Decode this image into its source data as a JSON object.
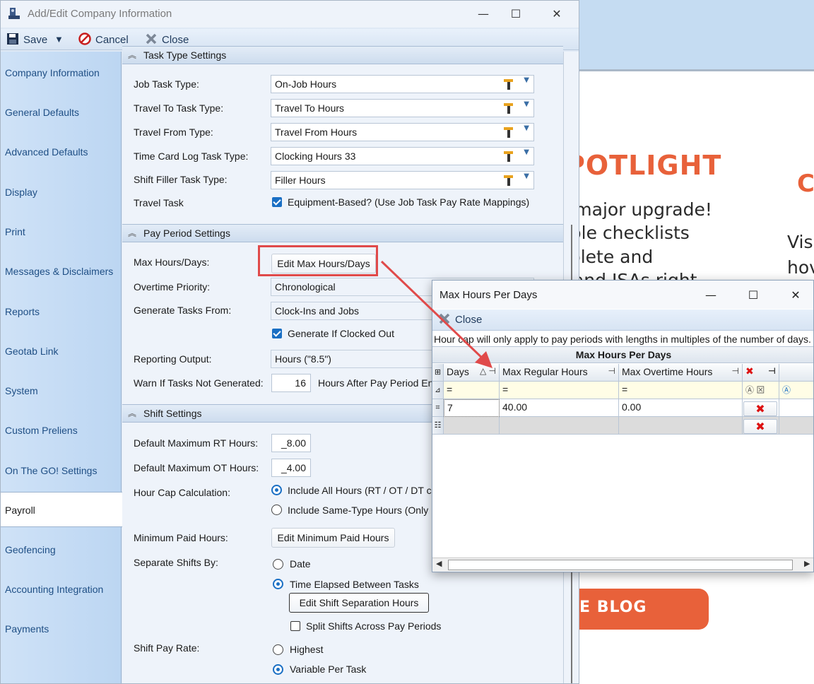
{
  "background_page": {
    "heading_fragment": "POTLIGHT",
    "right_letter": "C",
    "lines": [
      "a major upgrade!",
      "tiple checklists",
      "nplete and",
      "s and JSAs right"
    ],
    "right_lines": [
      "Vis",
      "hov"
    ],
    "blog_button": "E BLOG",
    "accent_color": "#e8613a"
  },
  "window": {
    "title": "Add/Edit Company Information",
    "controls": {
      "minimize": "—",
      "maximize": "☐",
      "close": "✕"
    }
  },
  "toolbar": {
    "save_label": "Save",
    "cancel_label": "Cancel",
    "close_label": "Close"
  },
  "sidebar": {
    "items": [
      {
        "label": "Company Information"
      },
      {
        "label": "General Defaults"
      },
      {
        "label": "Advanced Defaults"
      },
      {
        "label": "Display"
      },
      {
        "label": "Print"
      },
      {
        "label": "Messages & Disclaimers"
      },
      {
        "label": "Reports"
      },
      {
        "label": "Geotab Link"
      },
      {
        "label": "System"
      },
      {
        "label": "Custom Preliens"
      },
      {
        "label": "On The GO! Settings"
      },
      {
        "label": "Payroll",
        "active": true
      },
      {
        "label": "Geofencing"
      },
      {
        "label": "Accounting Integration"
      },
      {
        "label": "Payments"
      }
    ]
  },
  "task_type_settings": {
    "header": "Task Type Settings",
    "job_task_type": {
      "label": "Job Task Type:",
      "value": "On-Job Hours"
    },
    "travel_to": {
      "label": "Travel To Task Type:",
      "value": "Travel To Hours"
    },
    "travel_from": {
      "label": "Travel From Type:",
      "value": "Travel From Hours"
    },
    "time_card": {
      "label": "Time Card Log Task Type:",
      "value": "Clocking Hours 33"
    },
    "shift_filler": {
      "label": "Shift Filler Task Type:",
      "value": "Filler Hours"
    },
    "travel_task": {
      "label": "Travel Task",
      "checkbox_label": "Equipment-Based? (Use Job Task Pay Rate Mappings)",
      "checked": true
    }
  },
  "pay_period_settings": {
    "header": "Pay Period Settings",
    "max_hours": {
      "label": "Max Hours/Days:",
      "button": "Edit Max Hours/Days"
    },
    "overtime_priority": {
      "label": "Overtime Priority:",
      "value": "Chronological"
    },
    "generate_tasks_from": {
      "label": "Generate Tasks From:",
      "value": "Clock-Ins and Jobs"
    },
    "generate_if_clocked_out": {
      "label": "Generate If Clocked Out",
      "checked": true
    },
    "reporting_output": {
      "label": "Reporting Output:",
      "value": "Hours (\"8.5\")"
    },
    "warn_if_not_generated": {
      "label": "Warn If Tasks Not Generated:",
      "value": "16",
      "suffix": "Hours After Pay Period En"
    }
  },
  "shift_settings": {
    "header": "Shift Settings",
    "max_rt": {
      "label": "Default Maximum RT Hours:",
      "value": "_8.00"
    },
    "max_ot": {
      "label": "Default Maximum OT Hours:",
      "value": "_4.00"
    },
    "hour_cap": {
      "label": "Hour Cap Calculation:",
      "options": [
        "Include All Hours (RT / OT / DT co",
        "Include Same-Type Hours (Only R"
      ],
      "selected": 0
    },
    "min_paid": {
      "label": "Minimum Paid Hours:",
      "button": "Edit Minimum Paid Hours"
    },
    "separate_by": {
      "label": "Separate Shifts By:",
      "options": [
        "Date",
        "Time Elapsed Between Tasks"
      ],
      "selected": 1,
      "button": "Edit Shift Separation Hours"
    },
    "split_shifts": {
      "label": "Split Shifts Across Pay Periods",
      "checked": false
    },
    "shift_pay_rate": {
      "label": "Shift Pay Rate:",
      "options": [
        "Highest",
        "Variable Per Task"
      ],
      "selected": 1
    }
  },
  "popup": {
    "title": "Max Hours Per Days",
    "close_label": "Close",
    "note": "Hour cap will only apply to pay periods with lengths in multiples of the number of days.",
    "grid_caption": "Max Hours Per Days",
    "columns": [
      "Days",
      "Max Regular Hours",
      "Max Overtime Hours"
    ],
    "filter_op": "=",
    "rows": [
      {
        "days": "7",
        "max_regular": "40.00",
        "max_overtime": "0.00"
      }
    ]
  },
  "colors": {
    "highlight": "#e04a4a",
    "sidebar": "#c7ddf5",
    "checkbox": "#1a6fc4"
  }
}
